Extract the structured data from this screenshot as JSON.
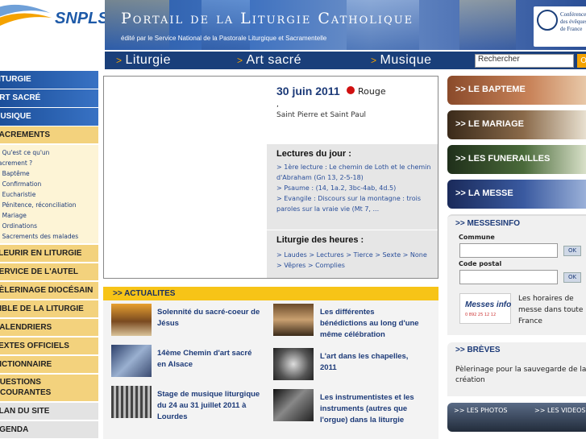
{
  "logo": {
    "text": "SNPLS"
  },
  "banner": {
    "title": "Portail de la Liturgie Catholique",
    "subtitle": "édité par le Service National de la Pastorale Liturgique et Sacramentelle",
    "bishops_text": "Conférence\ndes évêques\nde France"
  },
  "topnav": {
    "items": [
      {
        "arrow": ">",
        "label": "Liturgie"
      },
      {
        "arrow": ">",
        "label": "Art sacré"
      },
      {
        "arrow": ">",
        "label": "Musique"
      }
    ],
    "search_placeholder": "Rechercher",
    "search_button": "O"
  },
  "sidebar": {
    "blue_items": [
      "LITURGIE",
      "ART SACRÉ",
      "MUSIQUE"
    ],
    "sacrements": {
      "label": "SACREMENTS",
      "sub": [
        "> Qu'est ce qu'un",
        "sacrement ?",
        "> Baptême",
        "> Confirmation",
        "> Eucharistie",
        "> Pénitence, réconciliation",
        "> Mariage",
        "> Ordinations",
        "> Sacrements des malades"
      ]
    },
    "orange_items": [
      "FLEURIR EN LITURGIE",
      "SERVICE DE L'AUTEL",
      "PÈLERINAGE DIOCÉSAIN",
      "BIBLE DE LA LITURGIE",
      "CALENDRIERS",
      "TEXTES OFFICIELS",
      "DICTIONNAIRE",
      "QUESTIONS\nCOURANTES"
    ],
    "grey_items": [
      "PLAN DU SITE",
      "AGENDA"
    ]
  },
  "day": {
    "date": "30 juin 2011",
    "color_name": "Rouge",
    "color_hex": "#d01010",
    "comma": ",",
    "saints": "Saint Pierre et Saint Paul"
  },
  "readings": {
    "title": "Lectures du jour :",
    "lines": [
      "> 1ère lecture : Le chemin de Loth et le chemin",
      "d'Abraham (Gn 13, 2-5-18)",
      "> Psaume : (14, 1a.2, 3bc-4ab, 4d.5)",
      "> Evangile : Discours sur la montagne : trois",
      "paroles sur la vraie vie (Mt 7, ..."
    ]
  },
  "hours": {
    "title": "Liturgie des heures :",
    "lines": [
      "> Laudes > Lectures > Tierce > Sexte > None",
      "> Vêpres > Complies"
    ]
  },
  "actualites": {
    "heading": ">> ACTUALITES",
    "left": [
      "Solennité du sacré-coeur de\nJésus",
      "14ème Chemin d'art sacré\nen Alsace",
      "Stage de musique liturgique\ndu 24 au 31 juillet 2011 à\nLourdes"
    ],
    "right": [
      "Les différentes\nbénédictions au long d'une\nmême célébration",
      "L'art dans les chapelles,\n2011",
      "Les instrumentistes et les\ninstruments (autres que\nl'orgue) dans la liturgie"
    ]
  },
  "right": {
    "banners": [
      ">> LE BAPTEME",
      ">> LE MARIAGE",
      ">> LES FUNERAILLES",
      ">> LA MESSE"
    ],
    "messesinfo": {
      "heading": ">> MESSESINFO",
      "commune_label": "Commune",
      "code_label": "Code postal",
      "ok": "OK",
      "logo_text": "Messes info",
      "logo_phone": "0 892 25 12 12",
      "text": "Les horaires de\nmesse dans toute la\nFrance"
    },
    "breves": {
      "heading": ">> BRÈVES",
      "text": "Pèlerinage pour la sauvegarde de la\ncréation"
    },
    "media": {
      "photos": ">> LES PHOTOS",
      "videos": ">> LES VIDEOS"
    }
  }
}
